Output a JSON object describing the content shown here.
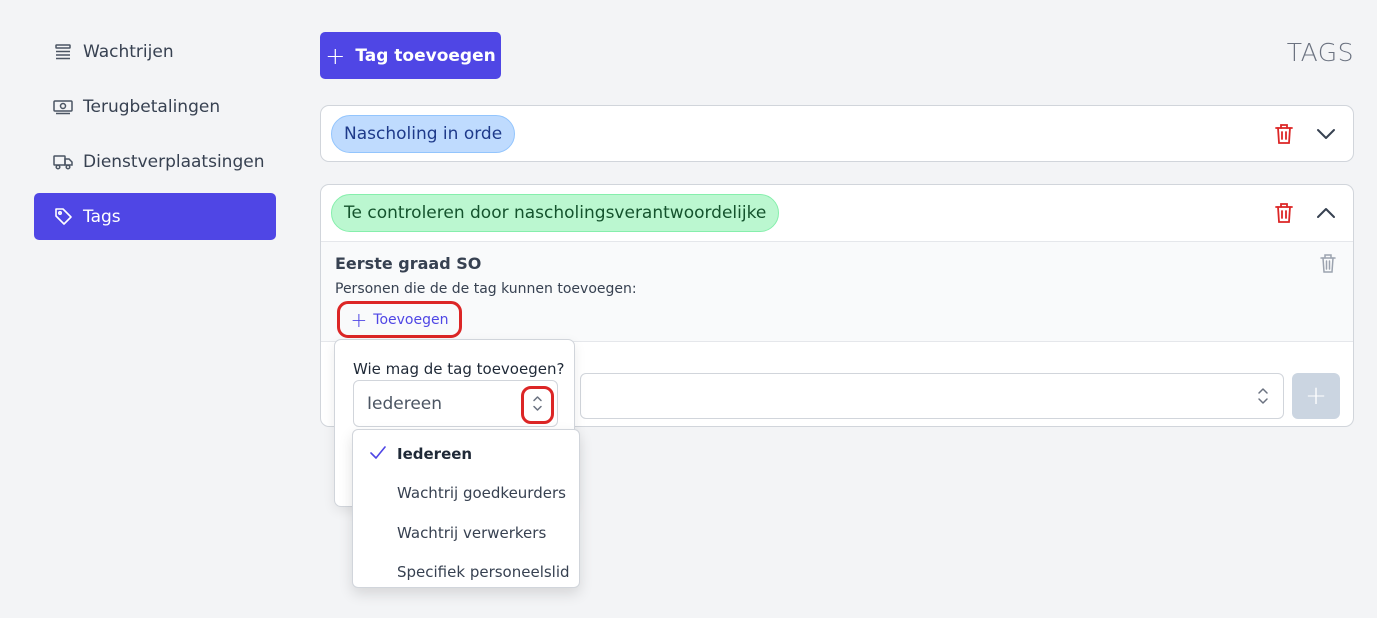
{
  "sidebar": {
    "items": [
      {
        "label": "Wachtrijen",
        "icon": "queue-icon"
      },
      {
        "label": "Terugbetalingen",
        "icon": "money-icon"
      },
      {
        "label": "Dienstverplaatsingen",
        "icon": "truck-icon"
      },
      {
        "label": "Tags",
        "icon": "tag-icon",
        "active": true
      }
    ]
  },
  "header": {
    "title": "TAGS",
    "add_tag_label": "Tag toevoegen"
  },
  "tags": [
    {
      "label": "Nascholing in orde",
      "color": "#bfdbfe",
      "expanded": false
    },
    {
      "label": "Te controleren door nascholingsverantwoordelijke",
      "color": "#bbf7d0",
      "expanded": true
    }
  ],
  "rule": {
    "title": "Eerste graad SO",
    "subtitle": "Personen die de de tag kunnen toevoegen:",
    "add_label": "Toevoegen"
  },
  "popover": {
    "label": "Wie mag de tag toevoegen?",
    "selected": "Iedereen"
  },
  "dropdown": {
    "options": [
      {
        "label": "Iedereen",
        "selected": true
      },
      {
        "label": "Wachtrij goedkeurders",
        "selected": false
      },
      {
        "label": "Wachtrij verwerkers",
        "selected": false
      },
      {
        "label": "Specifiek personeelslid",
        "selected": false
      }
    ]
  },
  "colors": {
    "accent": "#4f46e5",
    "danger": "#dc2626",
    "disabled": "#cbd5e1"
  }
}
